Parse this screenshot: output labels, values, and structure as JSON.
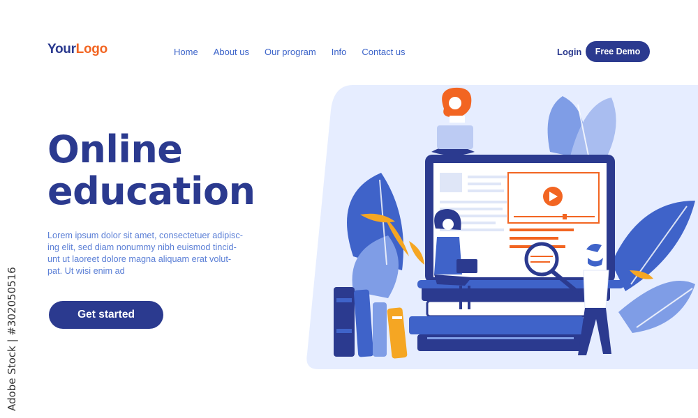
{
  "header": {
    "logo_part1": "Your",
    "logo_part2": "Logo",
    "nav": [
      "Home",
      "About us",
      "Our program",
      "Info",
      "Contact us"
    ],
    "login_label": "Login",
    "demo_label": "Free Demo"
  },
  "hero": {
    "title_lines": [
      "Online",
      "education"
    ],
    "body_lines": [
      "Lorem ipsum dolor sit amet, consectetuer adipisc-",
      "ing elit, sed diam nonummy nibh euismod tincid-",
      "unt ut laoreet dolore magna aliquam erat volut-",
      "pat. Ut wisi enim ad"
    ],
    "cta_label": "Get started"
  },
  "watermark": "Adobe Stock | #302050516",
  "colors": {
    "brand": "#2b3a8f",
    "accent": "#f26522",
    "link": "#3b63c9",
    "panel": "#e8efff"
  },
  "icons": [
    "play-icon",
    "magnifier-icon",
    "laptop-icon"
  ]
}
